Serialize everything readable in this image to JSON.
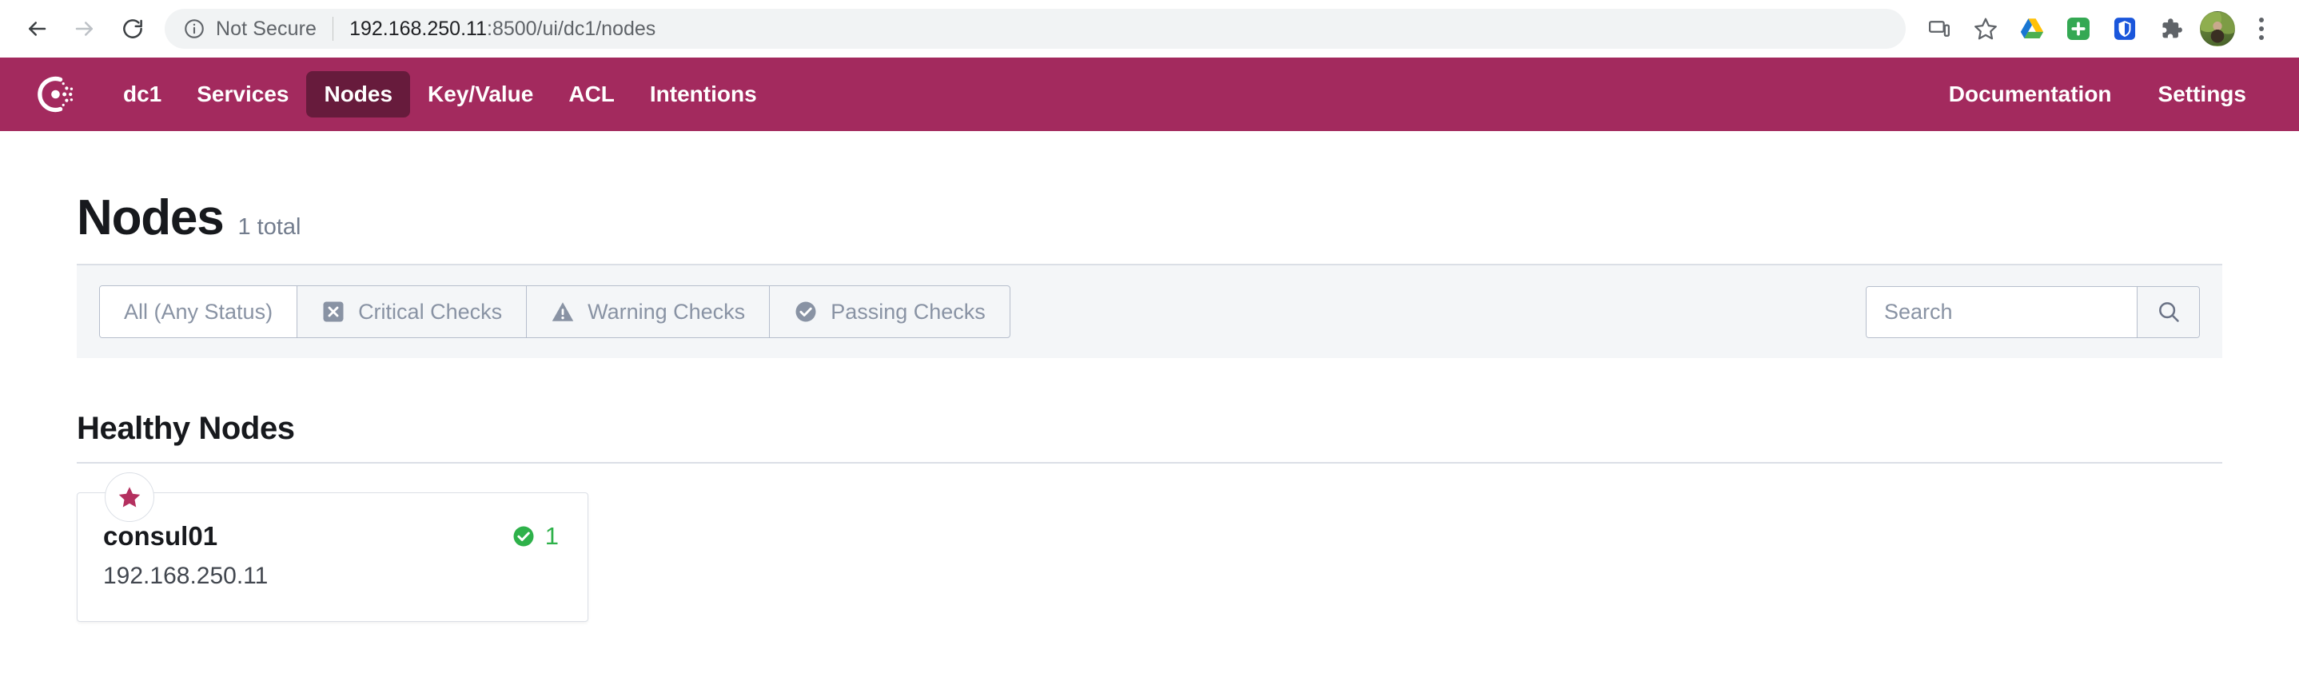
{
  "browser": {
    "back_icon": "arrow-left-icon",
    "forward_icon": "arrow-right-icon",
    "reload_icon": "reload-icon",
    "security_icon": "info-circle-icon",
    "security_label": "Not Secure",
    "url_host": "192.168.250.11",
    "url_path": ":8500/ui/dc1/nodes",
    "url_full": "192.168.250.11:8500/ui/dc1/nodes",
    "actions": [
      {
        "name": "cast-icon",
        "label": "Cast"
      },
      {
        "name": "star-bookmark-icon",
        "label": "Bookmark this tab"
      },
      {
        "name": "google-drive-icon",
        "label": "Google Drive"
      },
      {
        "name": "green-plus-extension-icon",
        "label": "Extension"
      },
      {
        "name": "shield-password-icon",
        "label": "Password manager"
      },
      {
        "name": "puzzle-extensions-icon",
        "label": "Extensions"
      },
      {
        "name": "profile-avatar",
        "label": "Profile"
      },
      {
        "name": "kebab-menu-icon",
        "label": "Customize and control"
      }
    ]
  },
  "consul_nav": {
    "logo_name": "consul-logo",
    "brand_color": "#A32A5E",
    "active_color": "#671B3C",
    "left_items": [
      {
        "label": "dc1",
        "active": false
      },
      {
        "label": "Services",
        "active": false
      },
      {
        "label": "Nodes",
        "active": true
      },
      {
        "label": "Key/Value",
        "active": false
      },
      {
        "label": "ACL",
        "active": false
      },
      {
        "label": "Intentions",
        "active": false
      }
    ],
    "right_items": [
      {
        "label": "Documentation"
      },
      {
        "label": "Settings"
      }
    ]
  },
  "page_header": {
    "title": "Nodes",
    "total": "1 total"
  },
  "filter_bar": {
    "filters": [
      {
        "label": "All (Any Status)",
        "icon": "",
        "active": true
      },
      {
        "label": "Critical Checks",
        "icon": "critical-x-icon",
        "active": false
      },
      {
        "label": "Warning Checks",
        "icon": "warning-triangle-icon",
        "active": false
      },
      {
        "label": "Passing Checks",
        "icon": "passing-check-icon",
        "active": false
      }
    ],
    "search": {
      "placeholder": "Search",
      "value": "",
      "button_icon": "search-icon"
    }
  },
  "healthy_section": {
    "title": "Healthy Nodes",
    "nodes": [
      {
        "name": "consul01",
        "address": "192.168.250.11",
        "leader": true,
        "leader_icon": "star-icon",
        "health_icon": "passing-check-green-icon",
        "health_count": "1",
        "health_color": "#2EB14A"
      }
    ]
  }
}
